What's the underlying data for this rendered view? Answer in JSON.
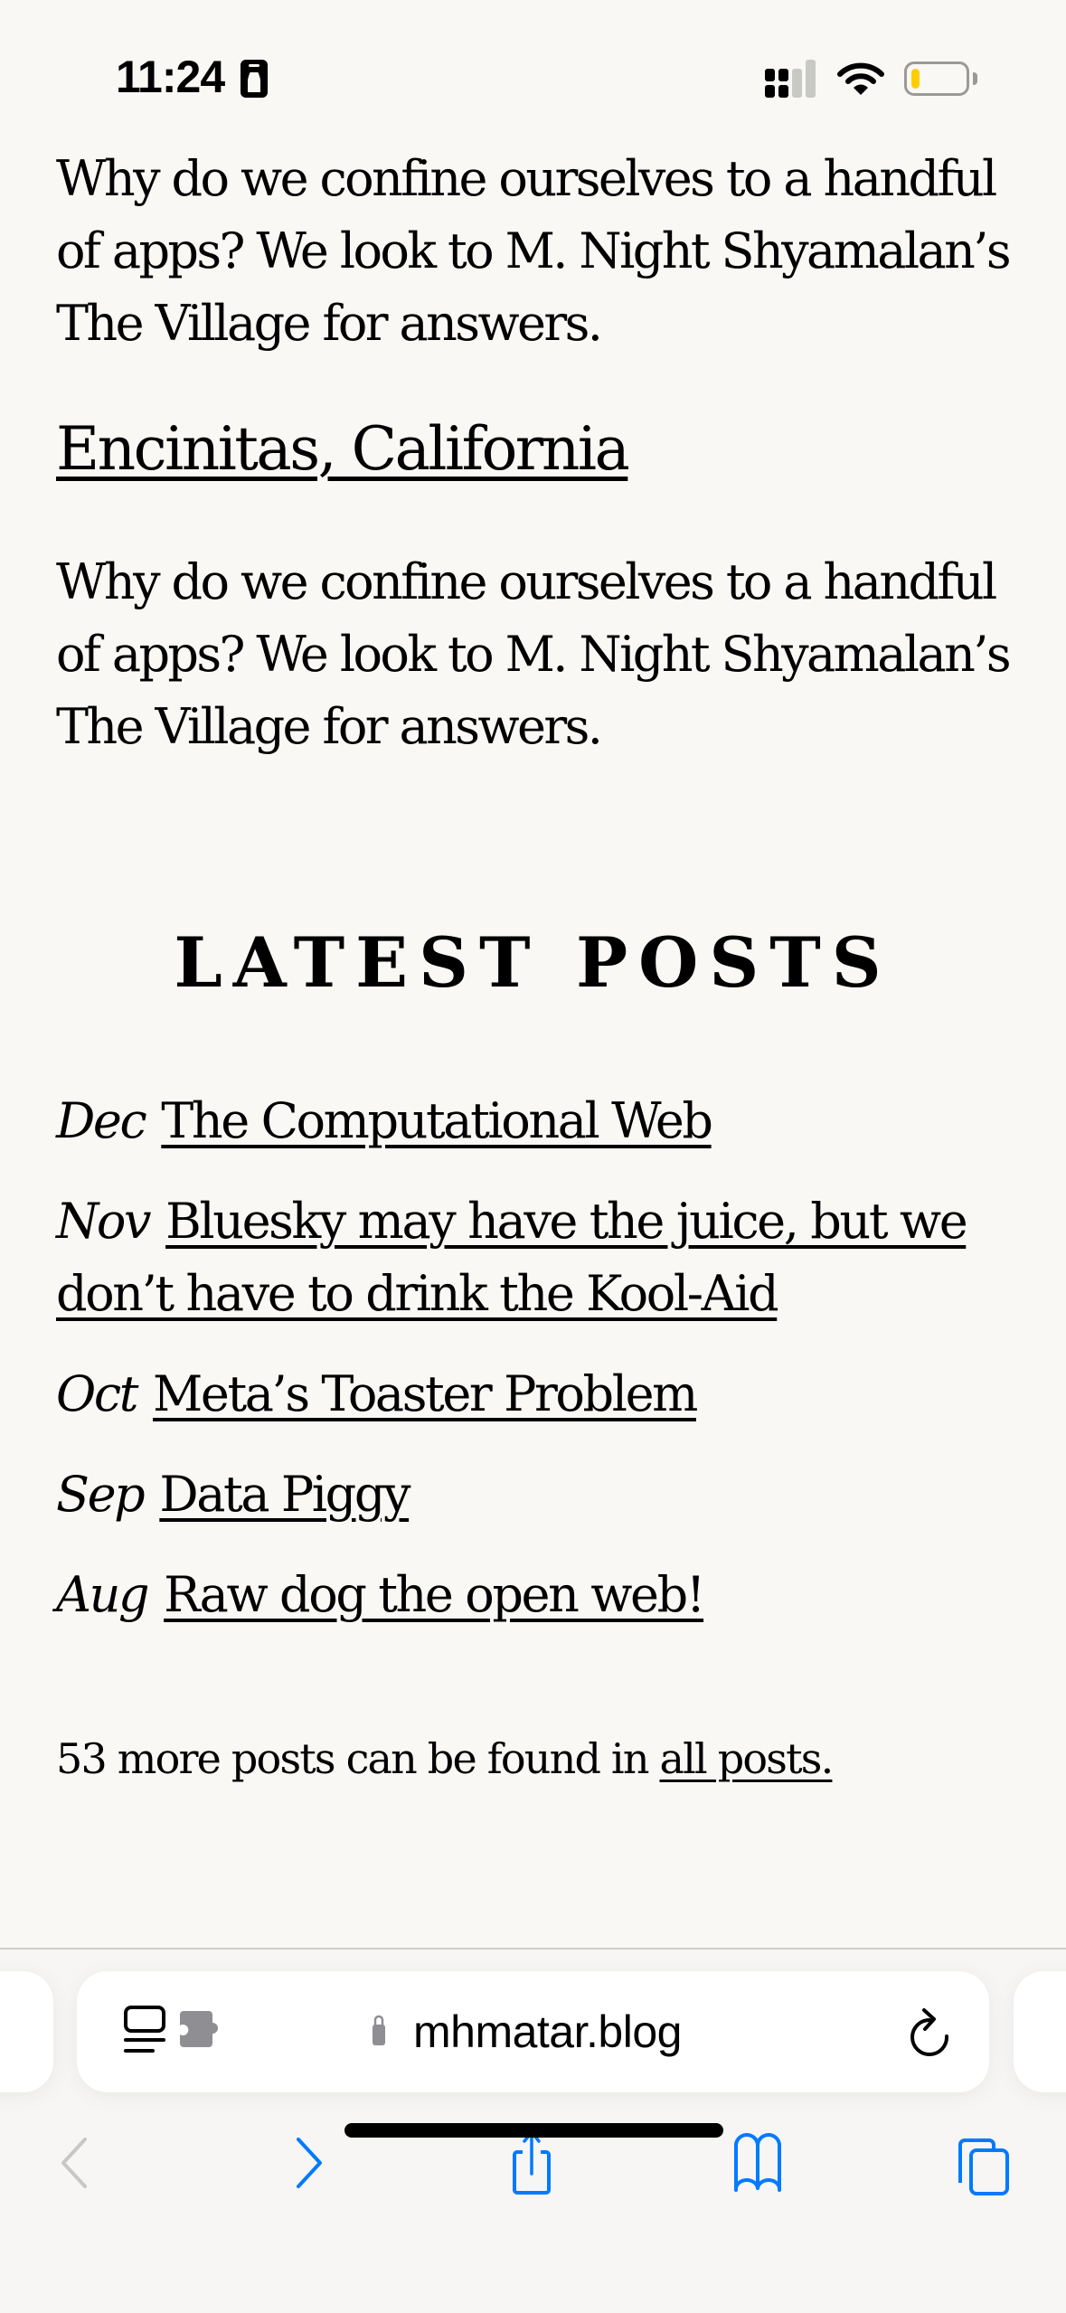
{
  "status_bar": {
    "time": "11:24",
    "focus_icon": "id-badge-icon",
    "signal_bars_active": 2,
    "signal_bars_total": 4,
    "battery_level_percent": 10,
    "battery_color": "#ffcc00"
  },
  "article": {
    "paragraph_1": "Why do we confine ourselves to a handful of apps? We look to M. Night Shyamalan’s The Village for answers.",
    "location_heading": "Encinitas, California",
    "paragraph_2": "Why do we confine ourselves to a handful of apps? We look to M. Night Shyamalan’s The Village for answers."
  },
  "latest_posts": {
    "heading": "LATEST POSTS",
    "items": [
      {
        "month": "Dec",
        "title": "The Computational Web"
      },
      {
        "month": "Nov",
        "title": "Bluesky may have the juice, but we don’t have to drink the Kool-Aid"
      },
      {
        "month": "Oct",
        "title": "Meta’s Toaster Problem"
      },
      {
        "month": "Sep",
        "title": "Data Piggy"
      },
      {
        "month": "Aug",
        "title": "Raw dog the open web!"
      }
    ],
    "more_text": "53 more posts can be found in ",
    "more_link": "all posts."
  },
  "browser": {
    "url": "mhmatar.blog",
    "accent_color": "#007aff",
    "disabled_color": "#c7c7c7",
    "toolbar": {
      "back": {
        "icon": "chevron-left-icon",
        "enabled": false
      },
      "forward": {
        "icon": "chevron-right-icon",
        "enabled": true
      },
      "share": {
        "icon": "share-icon"
      },
      "bookmarks": {
        "icon": "book-icon"
      },
      "tabs": {
        "icon": "tabs-icon"
      }
    }
  }
}
